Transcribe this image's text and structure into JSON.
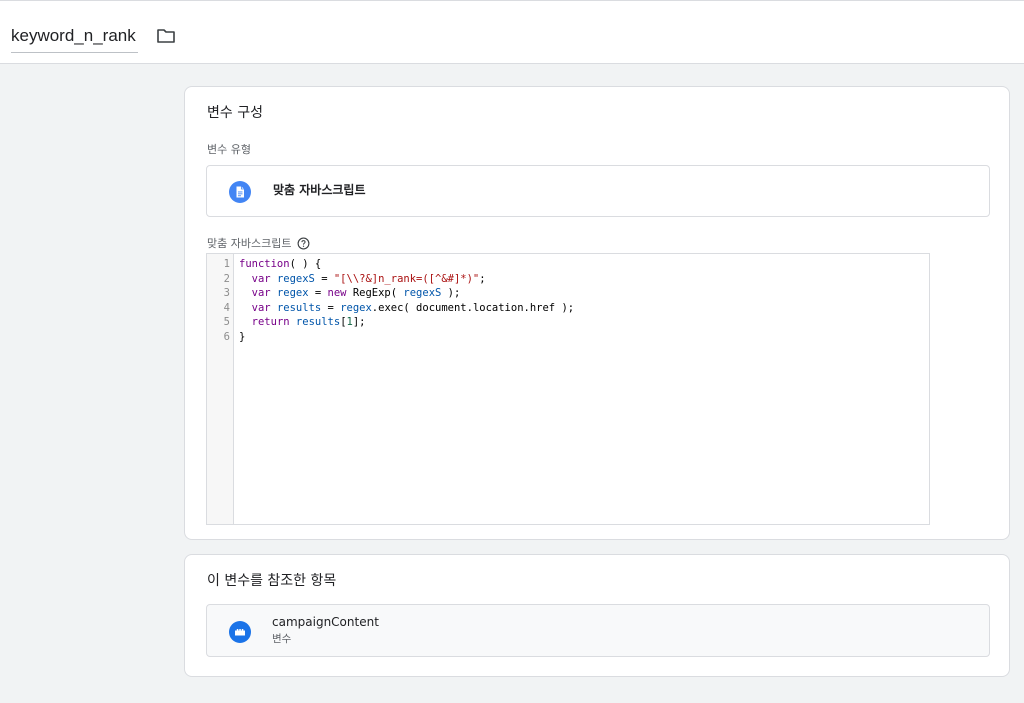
{
  "header": {
    "title": "keyword_n_rank",
    "folder_icon": "folder-icon"
  },
  "config": {
    "title": "변수 구성",
    "type_label": "변수 유형",
    "type_name": "맞춤 자바스크립트",
    "type_icon": "document-icon",
    "js_label": "맞춤 자바스크립트",
    "help_icon": "help-icon",
    "code": {
      "line_numbers": [
        "1",
        "2",
        "3",
        "4",
        "5",
        "6"
      ],
      "lines": [
        "function( ) {",
        "  var regexS = \"[\\\\?&]n_rank=([^&#]*)\";",
        "  var regex = new RegExp( regexS );",
        "  var results = regex.exec( document.location.href );",
        "  return results[1];",
        "}"
      ]
    }
  },
  "references": {
    "title": "이 변수를 참조한 항목",
    "items": [
      {
        "name": "campaignContent",
        "subtitle": "변수",
        "icon": "variable-block-icon"
      }
    ]
  },
  "colors": {
    "accent": "#1a73e8",
    "doc_icon": "#4285f4",
    "background": "#f1f3f4"
  }
}
